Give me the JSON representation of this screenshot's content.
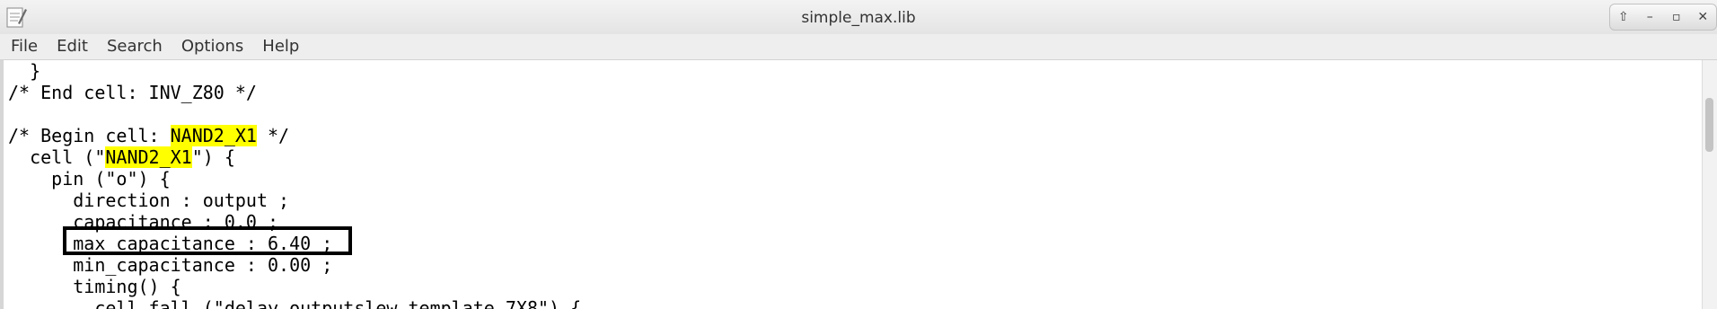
{
  "window": {
    "title": "simple_max.lib",
    "controls": [
      {
        "name": "maximize-up-icon",
        "glyph": "⇧"
      },
      {
        "name": "minimize-icon",
        "glyph": "–"
      },
      {
        "name": "restore-icon",
        "glyph": "▫"
      },
      {
        "name": "close-icon",
        "glyph": "✕"
      }
    ]
  },
  "menu": [
    "File",
    "Edit",
    "Search",
    "Options",
    "Help"
  ],
  "code": [
    "  }",
    "/* End cell: INV_Z80 */",
    "",
    [
      "/* Begin cell: ",
      {
        "hl": "NAND2_X1"
      },
      " */"
    ],
    [
      "  cell (\"",
      {
        "hl": "NAND2_X1"
      },
      "\") {"
    ],
    "    pin (\"o\") {",
    "      direction : output ;",
    "      capacitance : 0.0 ;",
    "      max_capacitance : 6.40 ;",
    "      min_capacitance : 0.00 ;",
    "      timing() {",
    "        cell_fall (\"delay_outputslew_template_7X8\") {"
  ],
  "highlight_color": "#ffff00"
}
